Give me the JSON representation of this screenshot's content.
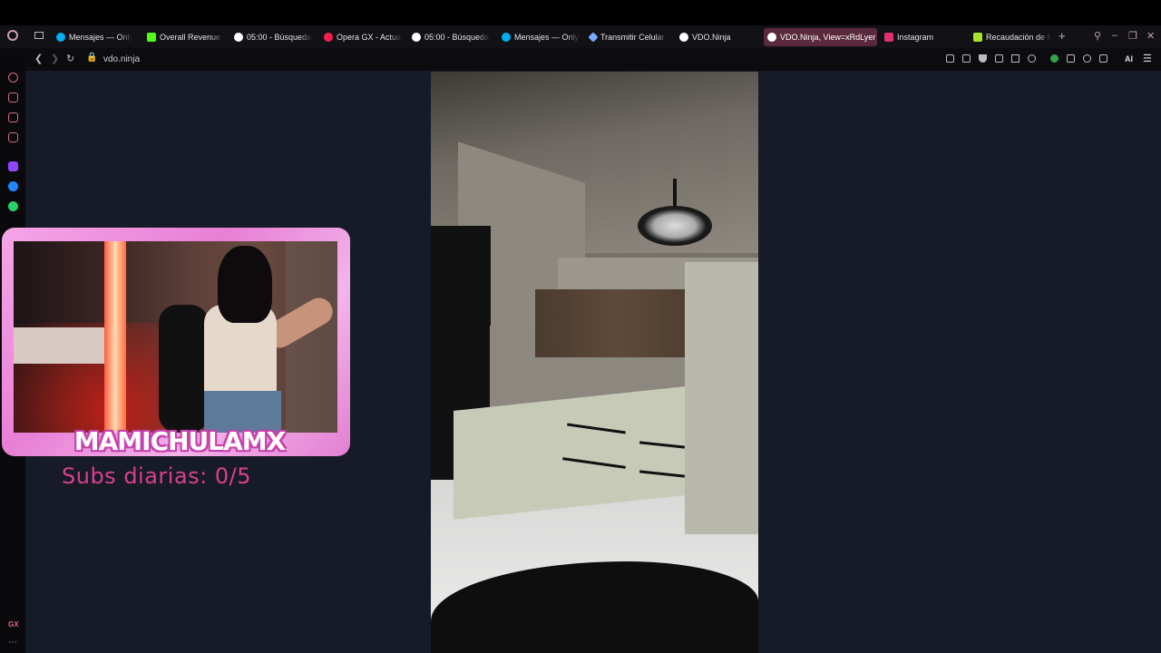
{
  "browser": {
    "tabs": [
      {
        "label": "Mensajes — OnlyF",
        "icon": "onlyfans-icon",
        "color": "#00aff0"
      },
      {
        "label": "Overall Revenue -",
        "icon": "kick-icon",
        "color": "#53fc18"
      },
      {
        "label": "05:00 - Búsqueda",
        "icon": "google-icon",
        "color": "#ffffff"
      },
      {
        "label": "Opera GX - Actuali",
        "icon": "opera-icon",
        "color": "#fa1e4e"
      },
      {
        "label": "05:00 - Búsqueda",
        "icon": "google-icon",
        "color": "#ffffff"
      },
      {
        "label": "Mensajes — OnlyF",
        "icon": "onlyfans-icon",
        "color": "#00aff0"
      },
      {
        "label": "Transmitir Celular",
        "icon": "vdo-star-icon",
        "color": "#7aa7ff"
      },
      {
        "label": "VDO.Ninja",
        "icon": "vdo-ninja-icon",
        "color": "#ffffff"
      },
      {
        "label": "VDO.Ninja, View=xRdLyer",
        "icon": "vdo-ninja-icon",
        "color": "#ffffff",
        "active": true
      },
      {
        "label": "Instagram",
        "icon": "instagram-icon",
        "color": "#e1306c"
      },
      {
        "label": "Recaudación de fo",
        "icon": "spreadsheet-icon",
        "color": "#a6e22e"
      }
    ],
    "new_tab": "+",
    "url": "vdo.ninja",
    "ai_label": "AI",
    "sidebar_bottom": "GX"
  },
  "overlay": {
    "streamer_name": "MAMICHULAMX",
    "subs_text": "Subs diarias: 0/5"
  },
  "colors": {
    "accent": "#e27fd1",
    "subs_text": "#d8408f",
    "page_bg": "#171b27"
  }
}
